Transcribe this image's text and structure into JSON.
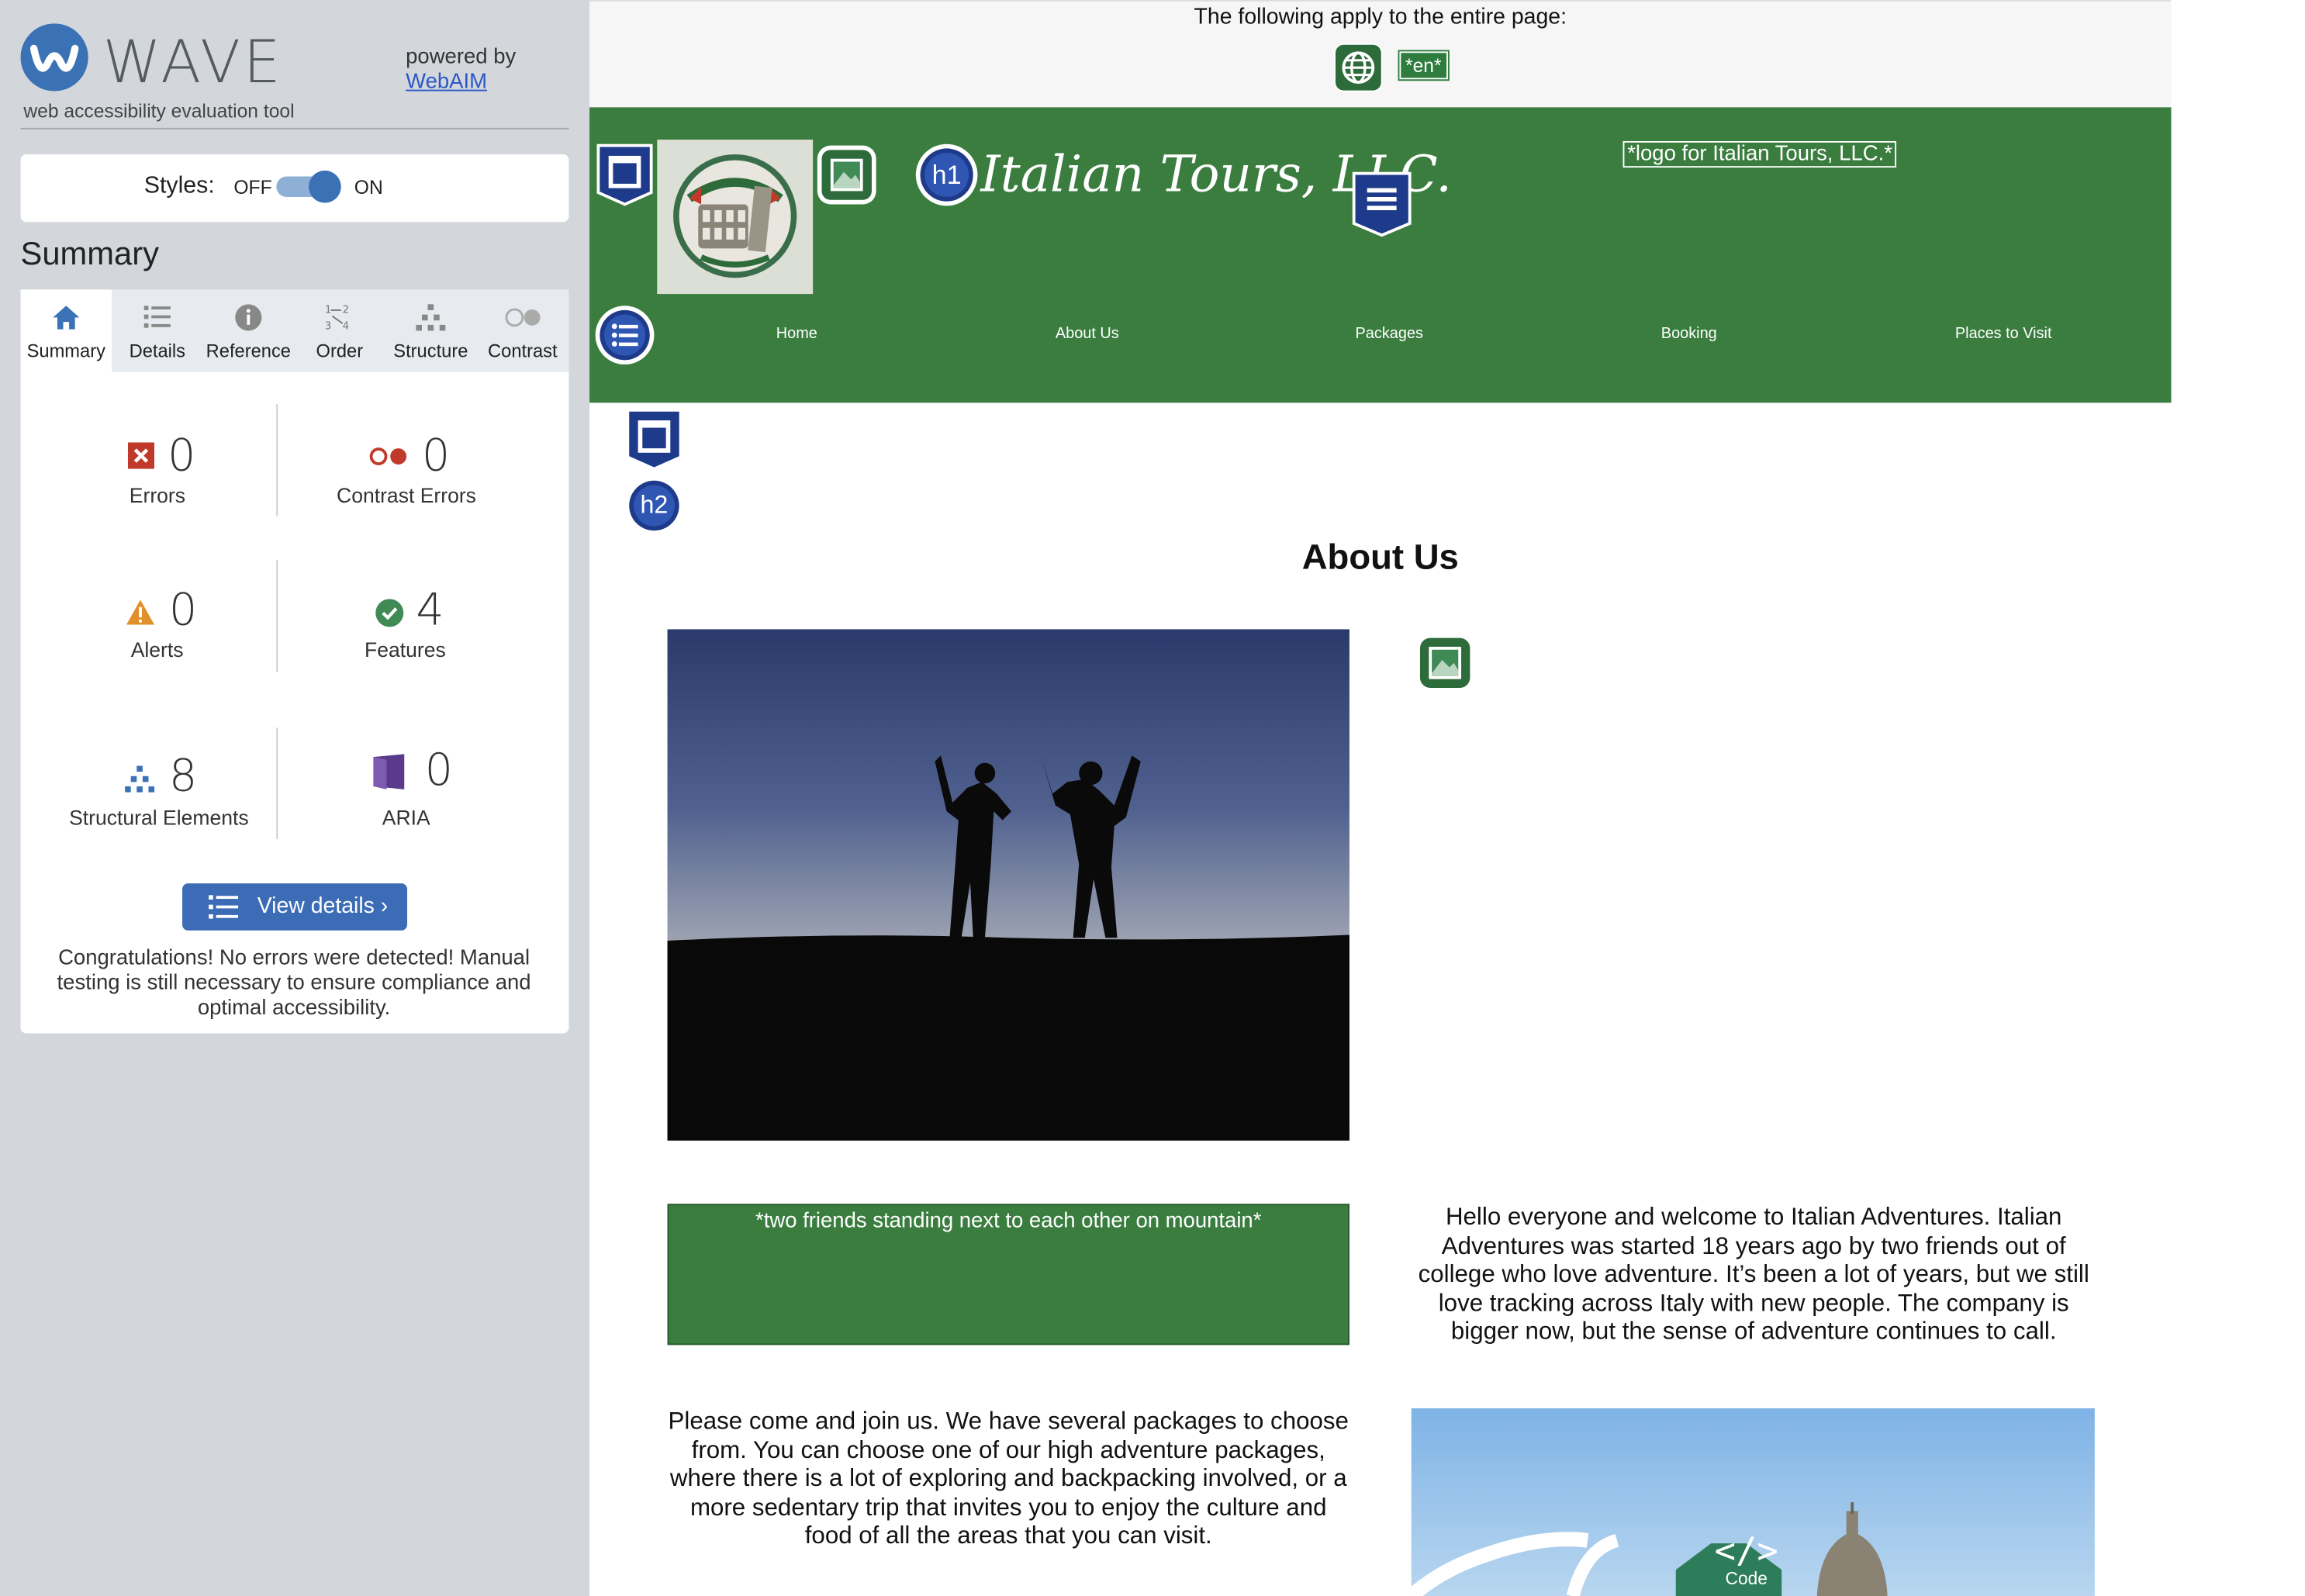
{
  "sidebar": {
    "title": "WAVE",
    "subtitle": "web accessibility evaluation tool",
    "powered_by": "powered by",
    "webaim_link": "WebAIM",
    "styles": {
      "label": "Styles:",
      "off": "OFF",
      "on": "ON"
    },
    "summary_heading": "Summary",
    "tabs": [
      {
        "label": "Summary",
        "icon": "home-icon"
      },
      {
        "label": "Details",
        "icon": "list-icon"
      },
      {
        "label": "Reference",
        "icon": "info-icon"
      },
      {
        "label": "Order",
        "icon": "order-icon"
      },
      {
        "label": "Structure",
        "icon": "structure-icon"
      },
      {
        "label": "Contrast",
        "icon": "contrast-icon"
      }
    ],
    "stats": {
      "errors": {
        "value": "0",
        "label": "Errors"
      },
      "contrast_errors": {
        "value": "0",
        "label": "Contrast Errors"
      },
      "alerts": {
        "value": "0",
        "label": "Alerts"
      },
      "features": {
        "value": "4",
        "label": "Features"
      },
      "structural": {
        "value": "8",
        "label": "Structural Elements"
      },
      "aria": {
        "value": "0",
        "label": "ARIA"
      }
    },
    "view_details": "View details ›",
    "congrats": "Congratulations! No errors were detected! Manual testing is still necessary to ensure compliance and optimal accessibility."
  },
  "page": {
    "top_notice": "The following apply to the entire page:",
    "lang_badge": "*en*",
    "brand": "Italian Tours, LLC.",
    "logo_alt": "*logo for Italian Tours, LLC.*",
    "nav": [
      "Home",
      "About Us",
      "Packages",
      "Booking",
      "Places to Visit"
    ],
    "h2_badge": "h2",
    "h1_badge": "h1",
    "about_title": "About Us",
    "image_alt": "*two friends standing next to each other on mountain*",
    "para1": "Hello everyone and welcome to Italian Adventures. Italian Adventures was started 18 years ago by two friends out of college who love adventure. It’s been a lot of years, but we still love tracking across Italy with new people. The company is bigger now, but the sense of adventure continues to call.",
    "para2": "Please come and join us. We have several packages to choose from. You can choose one of our high adventure packages, where there is a lot of exploring and backpacking involved, or a more sedentary trip that invites you to enjoy the culture and food of all the areas that you can visit.",
    "code_badge": "Code"
  },
  "colors": {
    "wave_blue": "#3a72b5",
    "header_green": "#3a7d3f",
    "error_red": "#c0392b",
    "alert_orange": "#e0902a",
    "feature_green": "#3f8a55",
    "aria_purple": "#5a3a8a"
  }
}
